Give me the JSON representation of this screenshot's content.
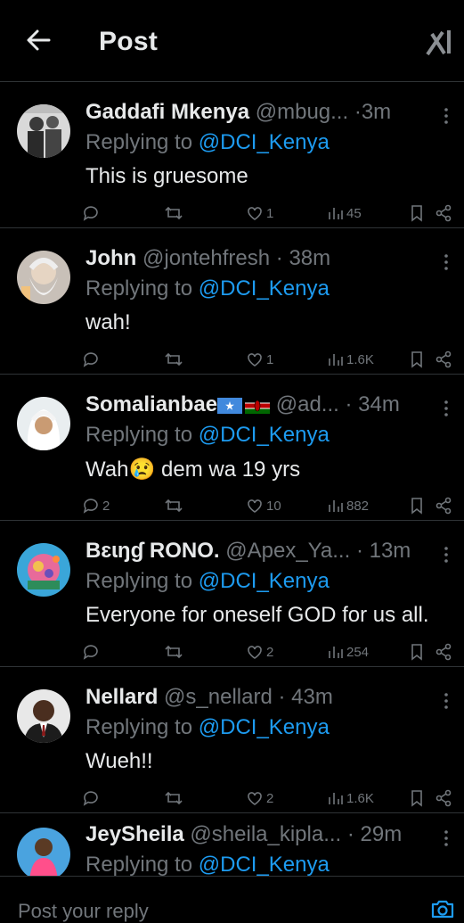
{
  "header": {
    "title": "Post",
    "back_icon": "arrow-left-icon",
    "logo_icon": "grok-logo-icon"
  },
  "replies": [
    {
      "name": "Gaddafi Mkenya",
      "handle": "@mbug...",
      "time": "3m",
      "replying_prefix": "Replying to",
      "replying_to": "@DCI_Kenya",
      "text": "This is gruesome",
      "counts": {
        "replies": "",
        "reposts": "",
        "likes": "1",
        "views": "45"
      }
    },
    {
      "name": "John",
      "handle": "@jontehfresh",
      "time": "38m",
      "replying_prefix": "Replying to",
      "replying_to": "@DCI_Kenya",
      "text": "wah!",
      "counts": {
        "replies": "",
        "reposts": "",
        "likes": "1",
        "views": "1.6K"
      }
    },
    {
      "name": "Somalianbae",
      "handle": "@ad...",
      "time": "34m",
      "replying_prefix": "Replying to",
      "replying_to": "@DCI_Kenya",
      "text": "Wah😢 dem wa 19 yrs",
      "counts": {
        "replies": "2",
        "reposts": "",
        "likes": "10",
        "views": "882"
      }
    },
    {
      "name": "Bɛɩŋɠ RONO.",
      "handle": "@Apex_Ya...",
      "time": "13m",
      "replying_prefix": "Replying to",
      "replying_to": "@DCI_Kenya",
      "text": "Everyone for oneself GOD for us all.",
      "counts": {
        "replies": "",
        "reposts": "",
        "likes": "2",
        "views": "254"
      }
    },
    {
      "name": "Nellard",
      "handle": "@s_nellard",
      "time": "43m",
      "replying_prefix": "Replying to",
      "replying_to": "@DCI_Kenya",
      "text": "Wueh!!",
      "counts": {
        "replies": "",
        "reposts": "",
        "likes": "2",
        "views": "1.6K"
      }
    },
    {
      "name": "JeySheila",
      "handle": "@sheila_kipla...",
      "time": "29m",
      "replying_prefix": "Replying to",
      "replying_to": "@DCI_Kenya",
      "text": "",
      "counts": {
        "replies": "",
        "reposts": "",
        "likes": "",
        "views": ""
      }
    }
  ],
  "composer": {
    "placeholder": "Post your reply",
    "camera_icon": "camera-icon"
  },
  "colors": {
    "background": "#000000",
    "text": "#e7e9ea",
    "muted": "#71767b",
    "accent": "#1d9bf0",
    "divider": "#2f3336"
  }
}
